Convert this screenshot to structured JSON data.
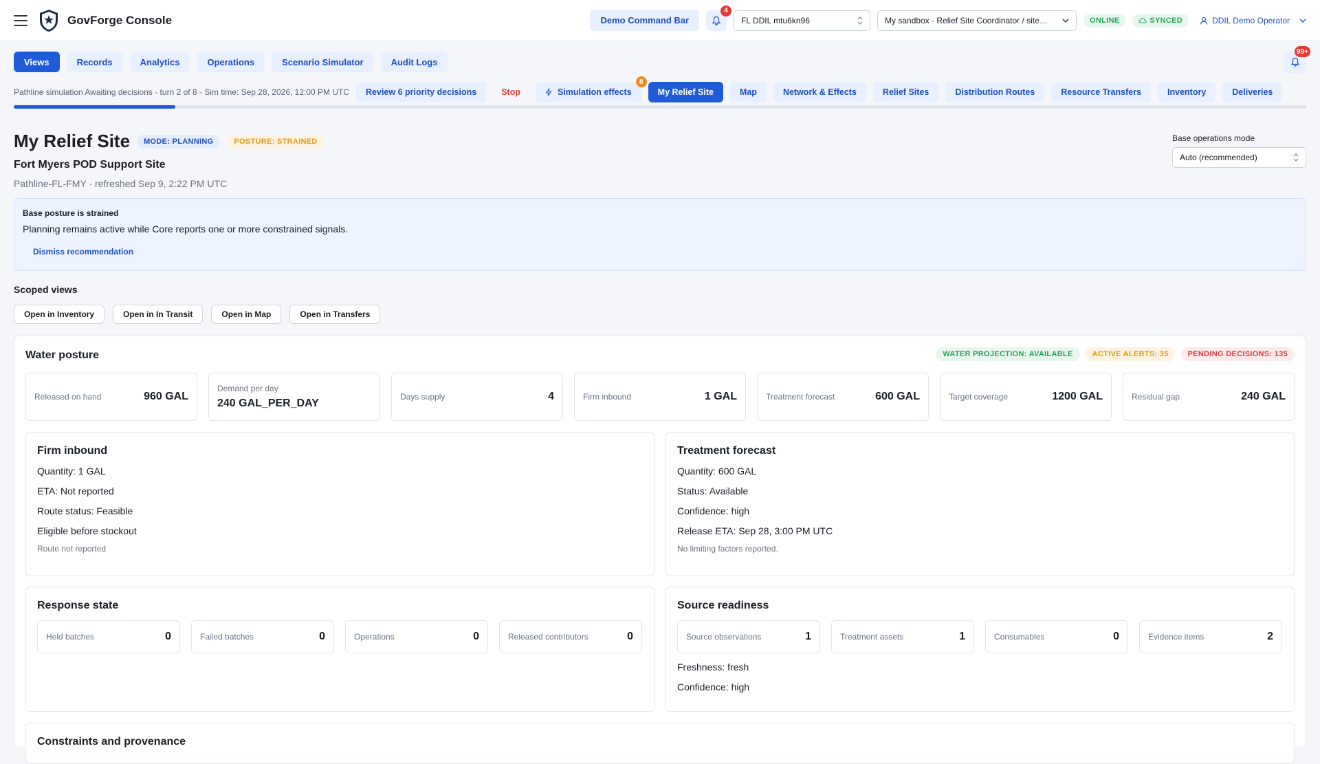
{
  "app": {
    "title": "GovForge Console"
  },
  "topbar": {
    "command_bar": "Demo Command Bar",
    "notification_count": "4",
    "site_select": "FL DDIL mtu6kn96",
    "sandbox_select": "My sandbox · Relief Site Coordinator / site…",
    "status_online": "ONLINE",
    "status_synced": "SYNCED",
    "operator": "DDIL Demo Operator"
  },
  "nav": {
    "tabs": [
      {
        "label": "Views"
      },
      {
        "label": "Records"
      },
      {
        "label": "Analytics"
      },
      {
        "label": "Operations"
      },
      {
        "label": "Scenario Simulator"
      },
      {
        "label": "Audit Logs"
      }
    ],
    "alert_count": "99+"
  },
  "simulation": {
    "status_text": "Pathline simulation Awaiting decisions - turn 2 of 8 - Sim time: Sep 28, 2026, 12:00 PM UTC",
    "review_label": "Review 6 priority decisions",
    "stop_label": "Stop",
    "effects_label": "Simulation effects",
    "effects_count": "8",
    "views": [
      {
        "label": "My Relief Site"
      },
      {
        "label": "Map"
      },
      {
        "label": "Network & Effects"
      },
      {
        "label": "Relief Sites"
      },
      {
        "label": "Distribution Routes"
      },
      {
        "label": "Resource Transfers"
      },
      {
        "label": "Inventory"
      },
      {
        "label": "Deliveries"
      }
    ],
    "progress_fraction": 0.125
  },
  "page": {
    "title": "My Relief Site",
    "mode_pill": "MODE: PLANNING",
    "posture_pill": "POSTURE: STRAINED",
    "site_name": "Fort Myers POD Support Site",
    "site_meta": "Pathline-FL-FMY · refreshed Sep 9, 2:22 PM UTC",
    "ops_mode_label": "Base operations mode",
    "ops_mode_value": "Auto (recommended)"
  },
  "banner": {
    "title": "Base posture is strained",
    "body": "Planning remains active while Core reports one or more constrained signals.",
    "dismiss": "Dismiss recommendation"
  },
  "scoped": {
    "label": "Scoped views",
    "buttons": [
      "Open in Inventory",
      "Open in In Transit",
      "Open in Map",
      "Open in Transfers"
    ]
  },
  "water": {
    "title": "Water posture",
    "pill_projection": "WATER PROJECTION: AVAILABLE",
    "pill_alerts": "ACTIVE ALERTS: 35",
    "pill_decisions": "PENDING DECISIONS: 135",
    "stats": [
      {
        "label": "Released on hand",
        "value": "960 GAL"
      },
      {
        "label": "Demand per day",
        "value": "240 GAL_PER_DAY"
      },
      {
        "label": "Days supply",
        "value": "4"
      },
      {
        "label": "Firm inbound",
        "value": "1 GAL"
      },
      {
        "label": "Treatment forecast",
        "value": "600 GAL"
      },
      {
        "label": "Target coverage",
        "value": "1200 GAL"
      },
      {
        "label": "Residual gap",
        "value": "240 GAL"
      }
    ]
  },
  "firm_inbound": {
    "title": "Firm inbound",
    "lines": [
      "Quantity: 1 GAL",
      "ETA: Not reported",
      "Route status: Feasible",
      "Eligible before stockout"
    ],
    "note": "Route not reported"
  },
  "treatment": {
    "title": "Treatment forecast",
    "lines": [
      "Quantity: 600 GAL",
      "Status: Available",
      "Confidence: high",
      "Release ETA: Sep 28, 3:00 PM UTC"
    ],
    "note": "No limiting factors reported."
  },
  "response": {
    "title": "Response state",
    "items": [
      {
        "label": "Held batches",
        "value": "0"
      },
      {
        "label": "Failed batches",
        "value": "0"
      },
      {
        "label": "Operations",
        "value": "0"
      },
      {
        "label": "Released contributors",
        "value": "0"
      }
    ]
  },
  "source": {
    "title": "Source readiness",
    "items": [
      {
        "label": "Source observations",
        "value": "1"
      },
      {
        "label": "Treatment assets",
        "value": "1"
      },
      {
        "label": "Consumables",
        "value": "0"
      },
      {
        "label": "Evidence items",
        "value": "2"
      }
    ],
    "lines": [
      "Freshness: fresh",
      "Confidence: high"
    ]
  },
  "constraints": {
    "title": "Constraints and provenance"
  },
  "colors": {
    "accent": "#1f5bd8",
    "accent_soft": "#e8efff",
    "ok": "#27a35a",
    "warn": "#e89a12",
    "danger": "#e0383c"
  },
  "icons": {
    "menu": "hamburger-icon",
    "logo": "shield-star-logo",
    "bell": "bell-icon",
    "bolt": "bolt-icon",
    "cloud": "cloud-check-icon",
    "user": "user-icon",
    "chevron": "chevron-down-icon"
  }
}
